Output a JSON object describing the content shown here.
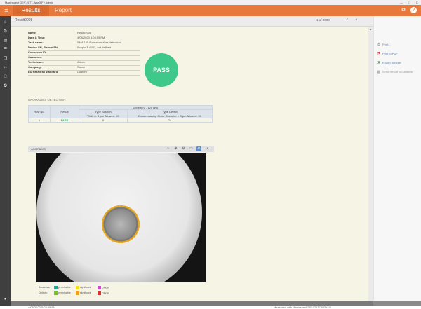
{
  "window": {
    "title": "Maxinspect DEV-2077-Wax3/F / Admin",
    "controls": [
      "—",
      "□",
      "✕"
    ]
  },
  "topbar": {
    "tabs": [
      {
        "label": "Results"
      },
      {
        "label": "Report"
      }
    ]
  },
  "subheader": {
    "report_name": "Result2008",
    "page_info": "1 of 2008",
    "prev": "‹",
    "next": "›"
  },
  "info": [
    {
      "label": "Name:",
      "value": "Result2008"
    },
    {
      "label": "Date & Time:",
      "value": "4/08/2020 5:03:59 PM"
    },
    {
      "label": "Task name:",
      "value": "SMA 125 fiber anomalies detection"
    },
    {
      "label": "Device SN, Fixture SN:",
      "value": "Scopio-B 6483, not defined"
    },
    {
      "label": "Connector ID:",
      "value": ""
    },
    {
      "label": "Customer:",
      "value": ""
    },
    {
      "label": "Technician:",
      "value": "Admin"
    },
    {
      "label": "Company:",
      "value": "Samie"
    },
    {
      "label": "ED Pass/Fail standard:",
      "value": "Custom"
    }
  ],
  "result_badge": "PASS",
  "anomalies_section_title": "ANOMALIES DETECTION",
  "anomaly_table": {
    "h_row_no": "Row No.",
    "h_result": "Result",
    "h_zone": "Zone A (0 - 125 μm)",
    "h_scratch": "Type Scratch",
    "h_scratch_sub": "Width > 3 μm Allowed: 99",
    "h_defect": "Type Defect",
    "h_defect_sub": "Encompassing Circle Diameter > 3 μm Allowed: 99",
    "row": {
      "no": "1",
      "result": "PASS",
      "scratch": "0",
      "defect": "74"
    }
  },
  "anomalies_panel": {
    "label": "Anomalies",
    "tools": [
      "search-icon",
      "zoom-in-icon",
      "zoom-out-icon",
      "fit-width-icon",
      "zoom-active-icon",
      "external-link-icon"
    ]
  },
  "legend": {
    "scratches_label": "Scratches:",
    "defects_label": "Defects:",
    "scratches": [
      {
        "name": "permissible",
        "color": "#1aa8a0"
      },
      {
        "name": "significant",
        "color": "#f0e020"
      },
      {
        "name": "critical",
        "color": "#e040e0"
      }
    ],
    "defects": [
      {
        "name": "permissible",
        "color": "#7ac02a"
      },
      {
        "name": "significant",
        "color": "#f0a020"
      },
      {
        "name": "critical",
        "color": "#e03030"
      }
    ]
  },
  "footer": {
    "datetime": "4/08/2020 5:03:59 PM",
    "measured_with": "Measured with Maxinspect DEV-2077-W3a3/F"
  },
  "actions": [
    {
      "icon": "print-icon",
      "label": "Print...",
      "enabled": true
    },
    {
      "icon": "pdf-icon",
      "label": "Print to PDF",
      "enabled": true
    },
    {
      "icon": "excel-icon",
      "label": "Export to Excel",
      "enabled": true
    },
    {
      "icon": "database-icon",
      "label": "Send Result to Database",
      "enabled": false
    }
  ],
  "colors": {
    "accent": "#e8793d",
    "pass": "#3ec98a",
    "sidebar": "#3f3f3f",
    "content_bg": "#f6f4e5"
  }
}
